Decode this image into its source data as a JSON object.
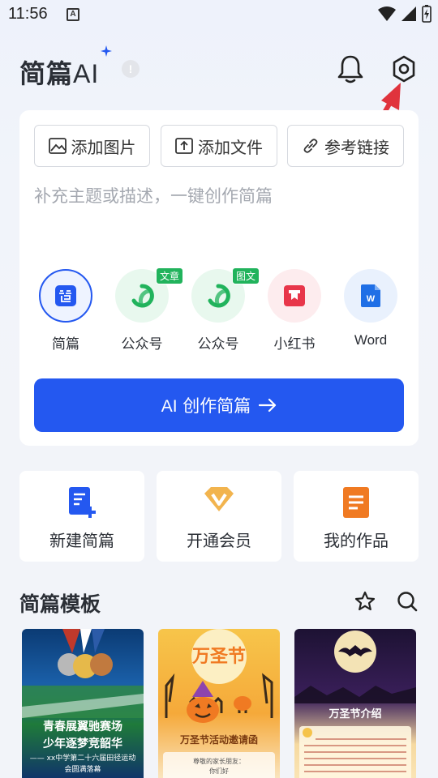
{
  "status_bar": {
    "time": "11:56",
    "notif_icon": "A"
  },
  "header": {
    "logo_text": "简篇",
    "logo_ai": "AI",
    "badge": "!"
  },
  "attach_buttons": [
    {
      "label": "添加图片",
      "icon": "image-icon"
    },
    {
      "label": "添加文件",
      "icon": "upload-file-icon"
    },
    {
      "label": "参考链接",
      "icon": "link-icon"
    }
  ],
  "prompt_placeholder": "补充主题或描述，一键创作简篇",
  "formats": [
    {
      "label": "简篇",
      "icon": "jianpian-icon",
      "selected": true
    },
    {
      "label": "公众号",
      "icon": "wechat-official-icon",
      "tag": "文章"
    },
    {
      "label": "公众号",
      "icon": "wechat-official-icon",
      "tag": "图文"
    },
    {
      "label": "小红书",
      "icon": "xiaohongshu-icon"
    },
    {
      "label": "Word",
      "icon": "word-icon"
    }
  ],
  "create_button": {
    "ai": "AI",
    "label": "创作简篇",
    "icon": "arrow-right-icon"
  },
  "quick_actions": [
    {
      "label": "新建简篇",
      "icon": "new-doc-icon"
    },
    {
      "label": "开通会员",
      "icon": "vip-icon"
    },
    {
      "label": "我的作品",
      "icon": "my-works-icon"
    }
  ],
  "templates": {
    "title": "简篇模板",
    "items": [
      {
        "line1": "青春展翼驰赛场",
        "line2": "少年逐梦竞韶华",
        "line3": "—— xx中学第二十六届田径运动",
        "line4": "会圆满落幕"
      },
      {
        "title": "万圣节",
        "subtitle": "万圣节活动邀请函",
        "greeting": "尊敬的家长朋友：",
        "greeting2": "你们好"
      },
      {
        "title": "万圣节介绍"
      }
    ]
  },
  "colors": {
    "primary": "#2458f0",
    "green": "#21b35c",
    "red": "#e8364a",
    "orange": "#f07a22"
  }
}
